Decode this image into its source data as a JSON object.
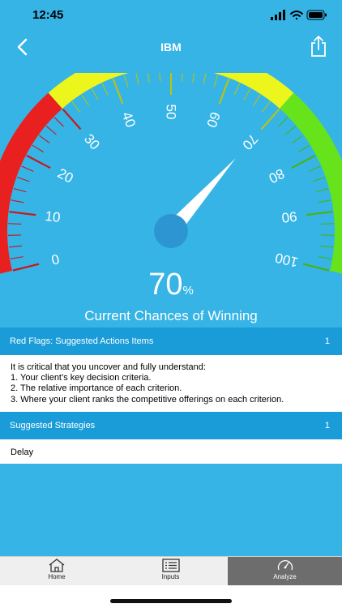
{
  "status": {
    "time": "12:45"
  },
  "nav": {
    "title": "IBM"
  },
  "gauge": {
    "value": 70,
    "percent_number": "70",
    "percent_sign": "%",
    "caption": "Current Chances of Winning",
    "tick_labels": [
      "0",
      "10",
      "20",
      "30",
      "40",
      "50",
      "60",
      "70",
      "80",
      "90",
      "100"
    ],
    "colors": {
      "red": "#e8201f",
      "yellow": "#ecf51c",
      "green": "#66e31a",
      "needle": "#ffffff",
      "hub": "#2e95d3"
    }
  },
  "red_flags": {
    "title": "Red Flags: Suggested Actions Items",
    "count": "1",
    "lines": [
      "It is critical that you uncover and fully understand:",
      "1. Your client’s key decision criteria.",
      "2. The relative importance of each criterion.",
      "3. Where your client ranks the competitive offerings on each criterion."
    ]
  },
  "strategies": {
    "title": "Suggested Strategies",
    "count": "1",
    "items": [
      "Delay"
    ]
  },
  "tabs": [
    {
      "label": "Home",
      "icon": "home-icon"
    },
    {
      "label": "Inputs",
      "icon": "list-icon"
    },
    {
      "label": "Analyze",
      "icon": "gauge-icon",
      "active": true
    }
  ],
  "theme": {
    "background": "#36b4e6",
    "header": "#1a9cd9",
    "active_tab": "#6d6d6d"
  }
}
